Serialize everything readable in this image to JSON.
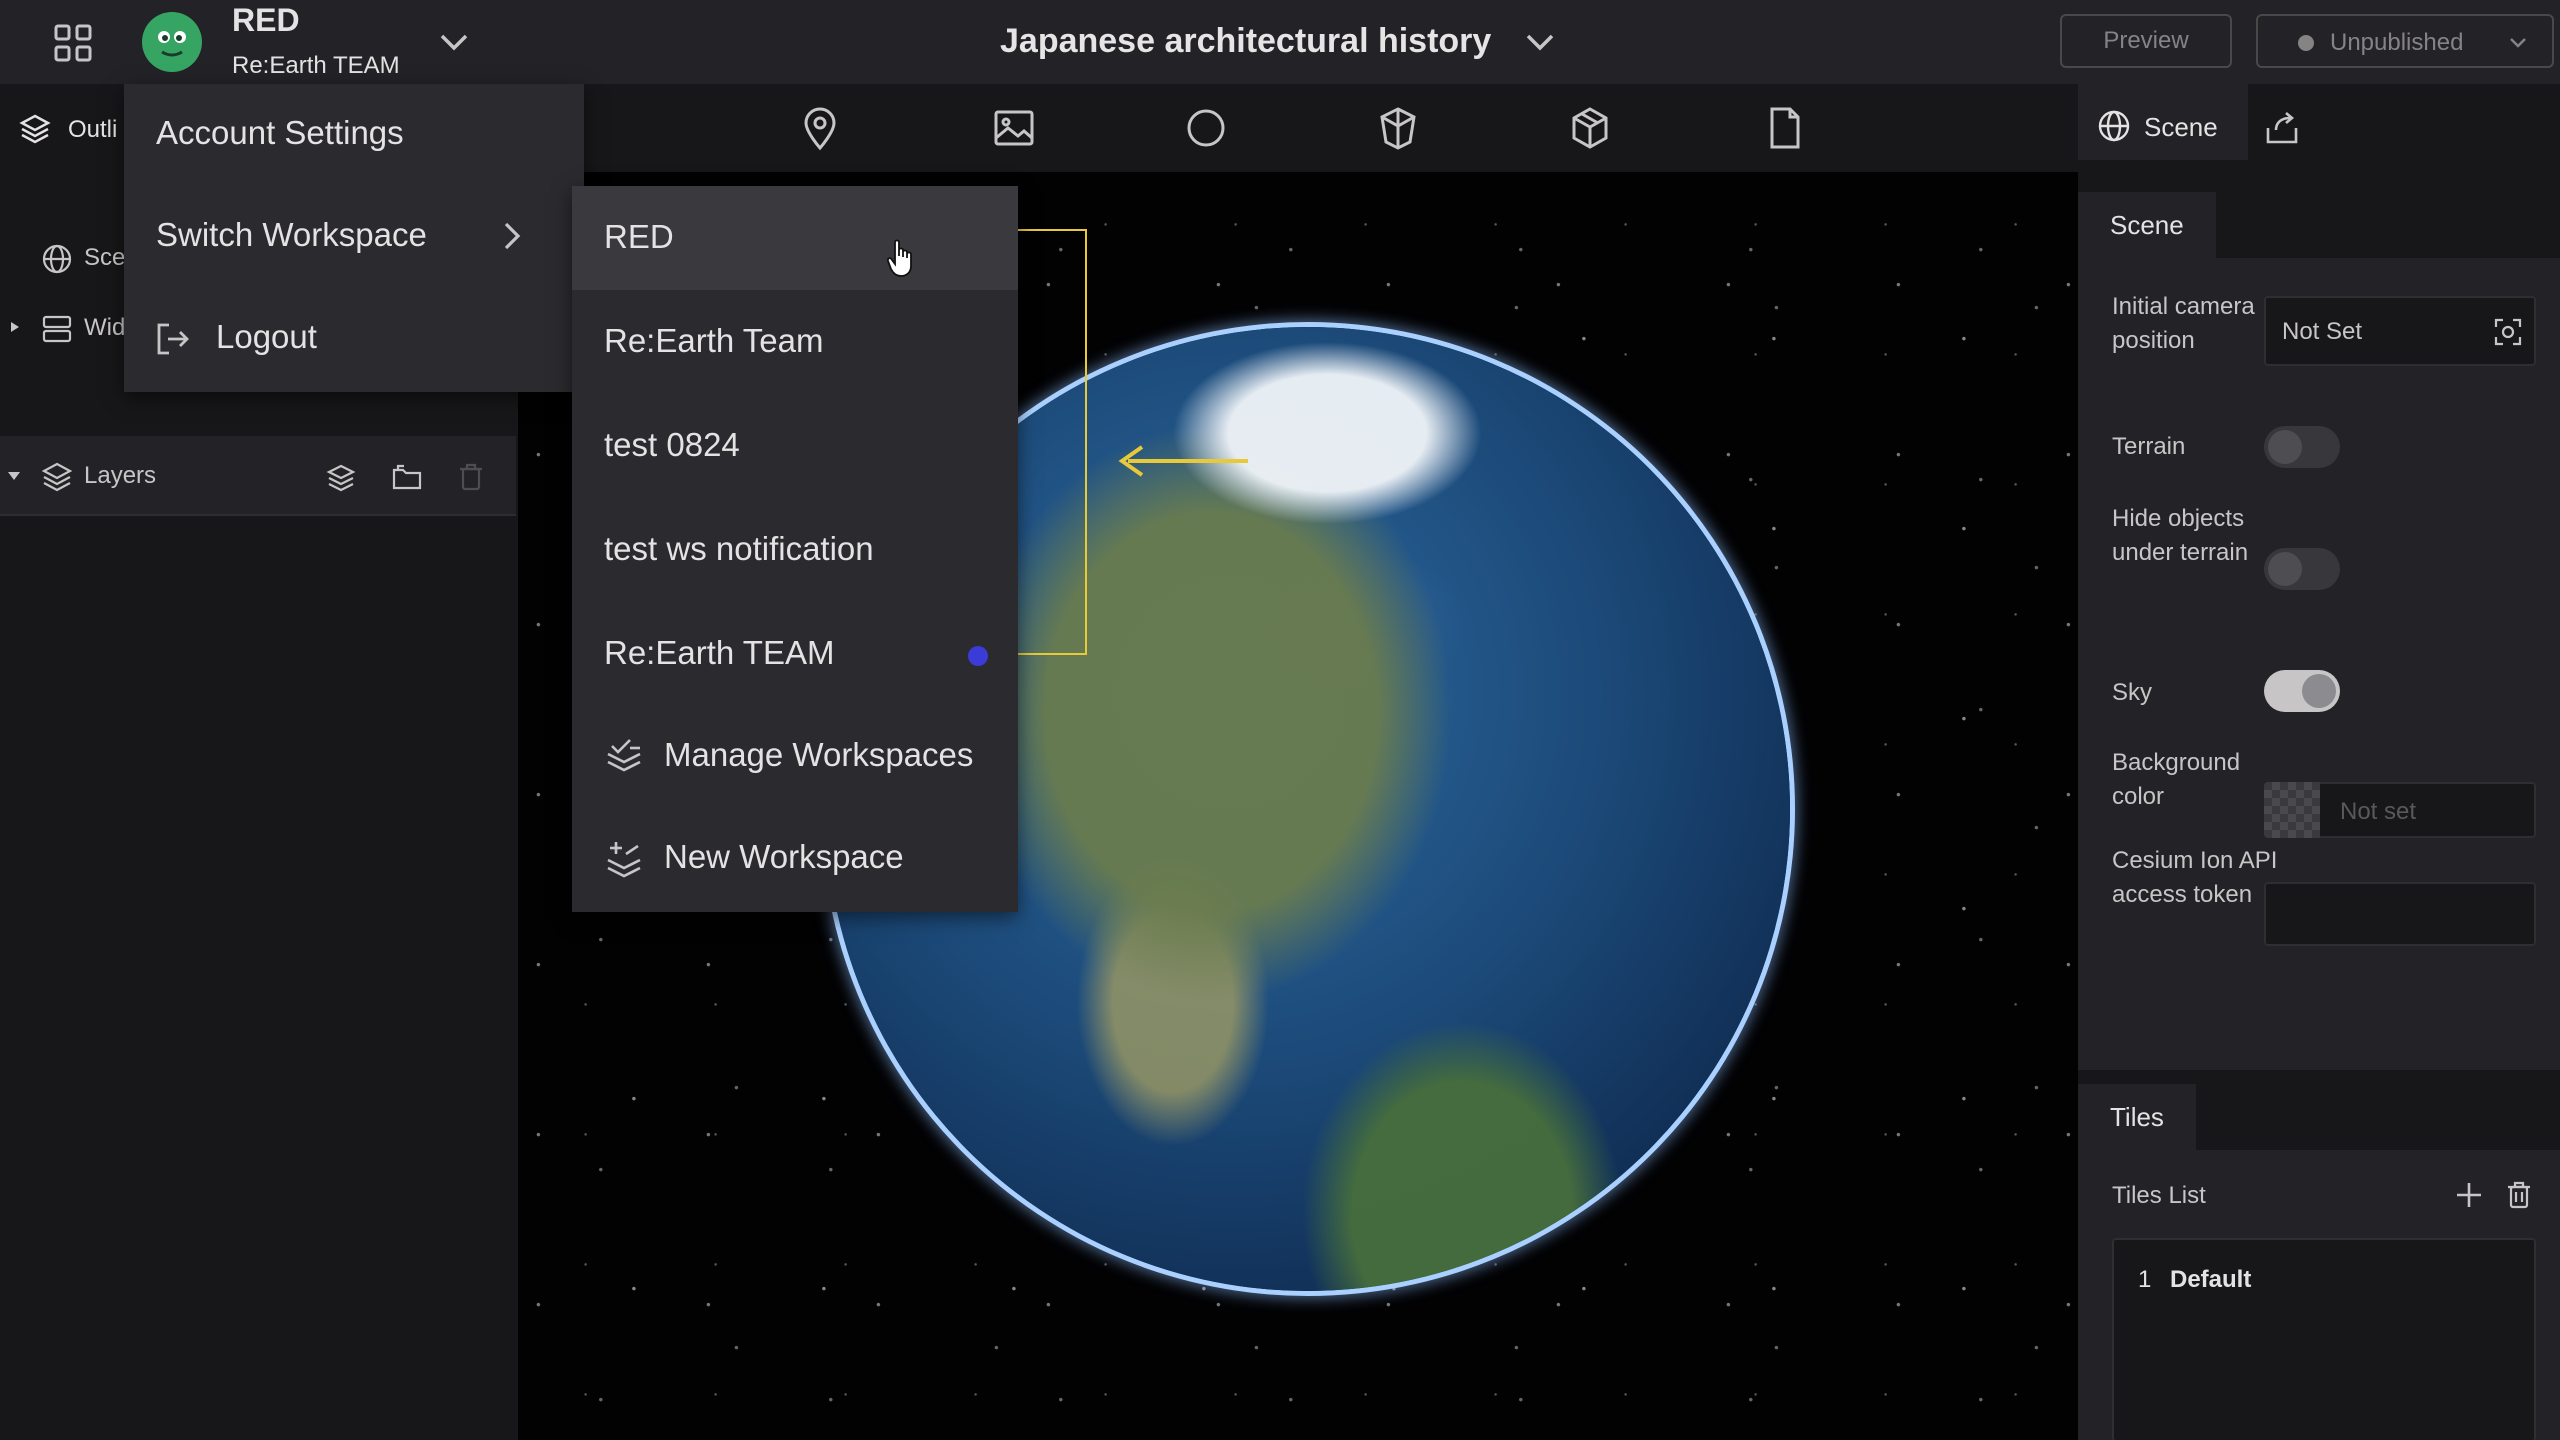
{
  "header": {
    "user": {
      "name": "RED",
      "team": "Re:Earth TEAM"
    },
    "project_title": "Japanese architectural history",
    "preview_label": "Preview",
    "publish_status": "Unpublished"
  },
  "left_panel": {
    "tab_label": "Outli",
    "tree": [
      {
        "label": "Sce",
        "icon": "globe-icon"
      },
      {
        "label": "Wid",
        "icon": "widgets-icon"
      }
    ],
    "layers_label": "Layers"
  },
  "account_menu": {
    "items": [
      {
        "label": "Account Settings"
      },
      {
        "label": "Switch Workspace"
      },
      {
        "label": "Logout"
      }
    ]
  },
  "workspace_menu": {
    "workspaces": [
      {
        "label": "RED",
        "hovered": true,
        "current": false
      },
      {
        "label": "Re:Earth Team",
        "hovered": false,
        "current": false
      },
      {
        "label": "test 0824",
        "hovered": false,
        "current": false
      },
      {
        "label": "test ws notification",
        "hovered": false,
        "current": false
      },
      {
        "label": "Re:Earth TEAM",
        "hovered": false,
        "current": true
      }
    ],
    "actions": [
      {
        "label": "Manage Workspaces",
        "icon": "manage-workspaces-icon"
      },
      {
        "label": "New Workspace",
        "icon": "new-workspace-icon"
      }
    ],
    "current_indicator_color": "#3b3bd8"
  },
  "toolbar": {
    "tools": [
      "pin-icon",
      "image-icon",
      "circle-icon",
      "box-icon",
      "model-icon",
      "file-icon"
    ]
  },
  "right_panel": {
    "tab_label": "Scene",
    "scene_section": {
      "title": "Scene",
      "camera": {
        "label": "Initial camera position",
        "value": "Not Set"
      },
      "terrain": {
        "label": "Terrain",
        "on": false
      },
      "hide_objects": {
        "label": "Hide objects under terrain",
        "on": false
      },
      "sky": {
        "label": "Sky",
        "on": true
      },
      "background": {
        "label": "Background color",
        "placeholder": "Not set"
      },
      "cesium_token": {
        "label": "Cesium Ion API access token",
        "value": ""
      }
    },
    "tiles_section": {
      "title": "Tiles",
      "list_label": "Tiles List",
      "items": [
        {
          "index": "1",
          "name": "Default"
        }
      ]
    }
  },
  "colors": {
    "header_bg": "#232226",
    "panel_bg": "#171618",
    "menu_bg": "#2b2a2e",
    "menu_hover": "#3a393d",
    "annotation": "#e8c93a",
    "globe_rim": "#a9d0ff"
  }
}
